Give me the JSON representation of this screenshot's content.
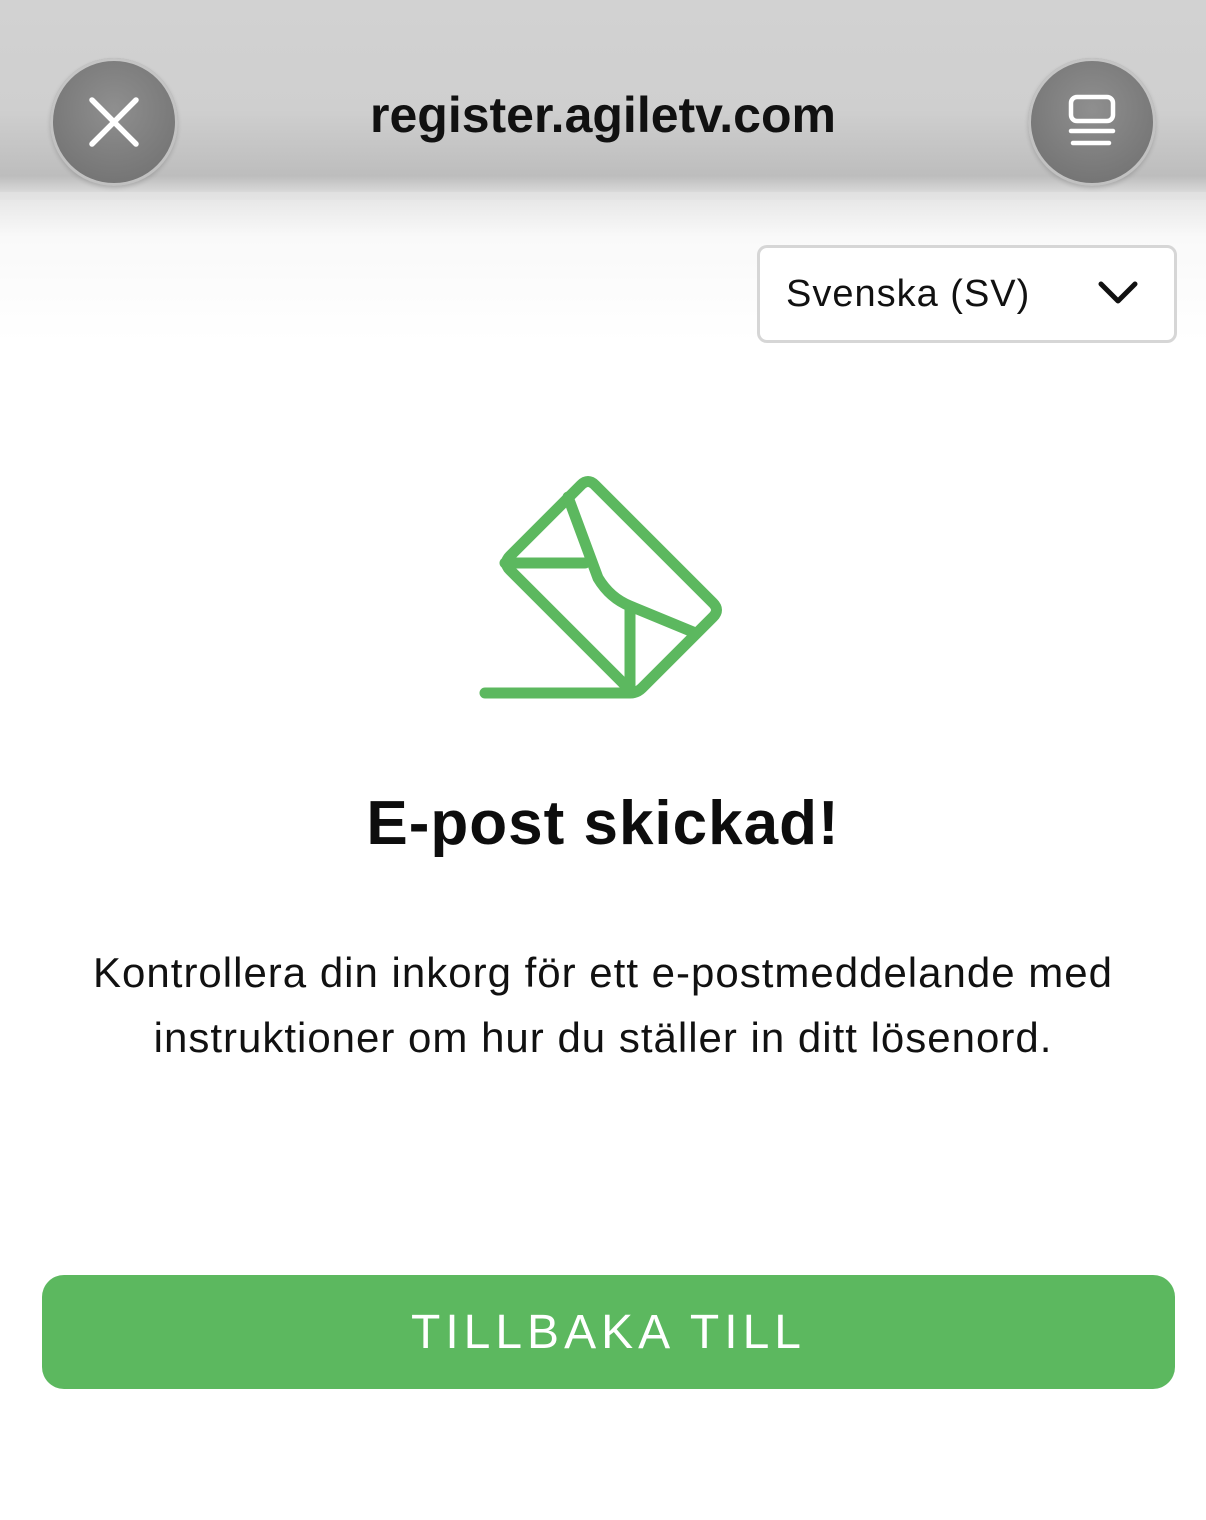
{
  "browser": {
    "url": "register.agiletv.com",
    "close_icon": "close-icon",
    "reader_icon": "reader-mode-icon"
  },
  "language": {
    "selected": "Svenska (SV)",
    "chevron_icon": "chevron-down-icon"
  },
  "content": {
    "icon": "envelope-sent-icon",
    "heading": "E-post skickad!",
    "message": "Kontrollera din inkorg för ett e-postmeddelande med instruktioner om hur du ställer in ditt lösenord.",
    "button_label": "TILLBAKA TILL"
  },
  "colors": {
    "accent": "#5cb85f",
    "topbar": "#cfcfcf"
  }
}
